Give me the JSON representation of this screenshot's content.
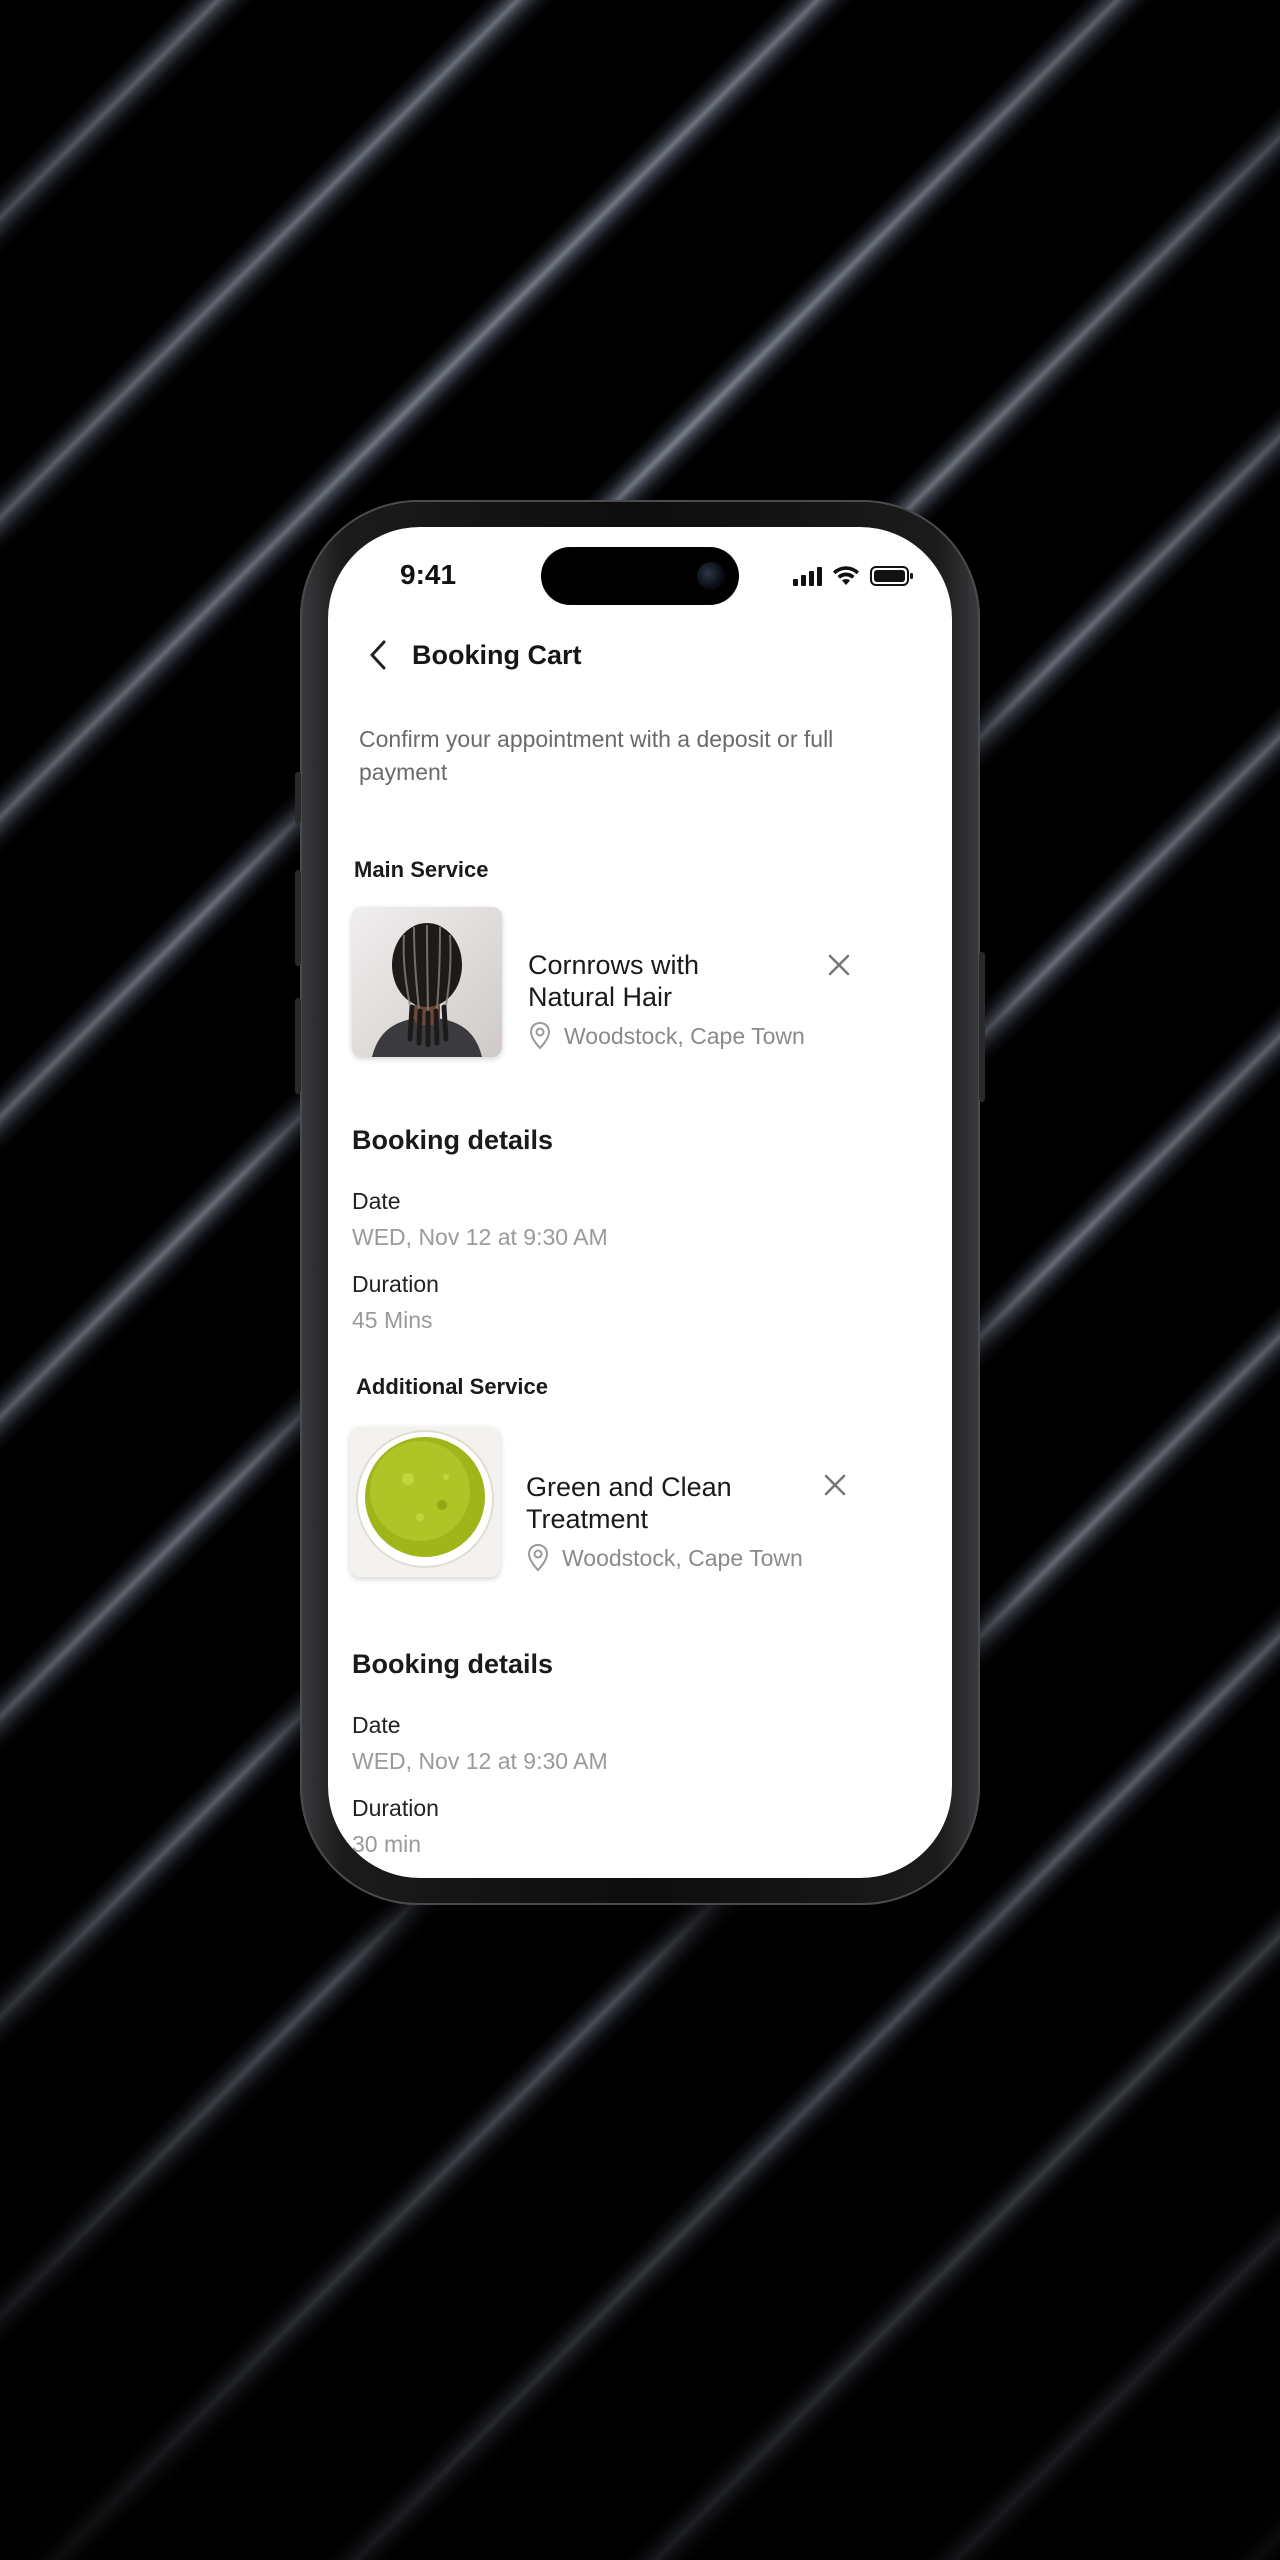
{
  "status_bar": {
    "time": "9:41"
  },
  "header": {
    "title": "Booking Cart",
    "back_icon": "chevron-left-icon"
  },
  "subtitle": "Confirm your appointment with a deposit or full payment",
  "main_service": {
    "section_label": "Main Service",
    "name": "Cornrows with Natural Hair",
    "location": "Woodstock, Cape Town",
    "booking_details": {
      "title": "Booking details",
      "date_label": "Date",
      "date_value": "WED, Nov 12 at 9:30 AM",
      "duration_label": "Duration",
      "duration_value": "45 Mins"
    }
  },
  "additional_service": {
    "section_label": "Additional Service",
    "name": "Green and Clean Treatment",
    "location": "Woodstock, Cape Town",
    "booking_details": {
      "title": "Booking details",
      "date_label": "Date",
      "date_value": "WED, Nov 12 at 9:30 AM",
      "duration_label": "Duration",
      "duration_value": "30 min"
    }
  },
  "colors": {
    "text_primary": "#1a1a1a",
    "text_secondary": "#6a6a6a",
    "text_muted": "#9a9a9a",
    "screen_bg": "#ffffff",
    "treatment_green": "#a6bf1c"
  }
}
